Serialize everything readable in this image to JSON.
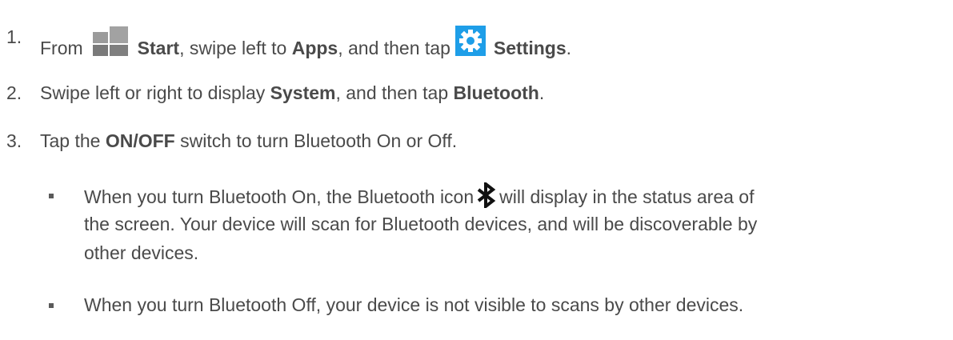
{
  "steps": [
    {
      "number": "1.",
      "parts": {
        "t1": "From",
        "b1": "Start",
        "t2": ", swipe left to ",
        "b2": "Apps",
        "t3": ", and then tap",
        "b3": "Settings",
        "t4": "."
      }
    },
    {
      "number": "2.",
      "parts": {
        "t1": "Swipe left or right to display ",
        "b1": "System",
        "t2": ", and then tap ",
        "b2": "Bluetooth",
        "t3": "."
      }
    },
    {
      "number": "3.",
      "parts": {
        "t1": "Tap the ",
        "b1": "ON/OFF",
        "t2": " switch to turn Bluetooth On or Off."
      }
    }
  ],
  "bullets": [
    {
      "line1a": "When you turn Bluetooth On, the Bluetooth icon",
      "line1b": "will display in the status area of",
      "line2": "the screen. Your device will scan for Bluetooth devices, and will be discoverable by",
      "line3": "other devices."
    },
    {
      "line1": "When you turn Bluetooth Off, your device is not visible to scans by other devices."
    }
  ],
  "icons": {
    "start": "windows-start-icon",
    "settings": "settings-gear-icon",
    "bluetooth": "bluetooth-icon"
  },
  "colors": {
    "text": "#4a4a4a",
    "settings_tile": "#1e9ee8"
  }
}
